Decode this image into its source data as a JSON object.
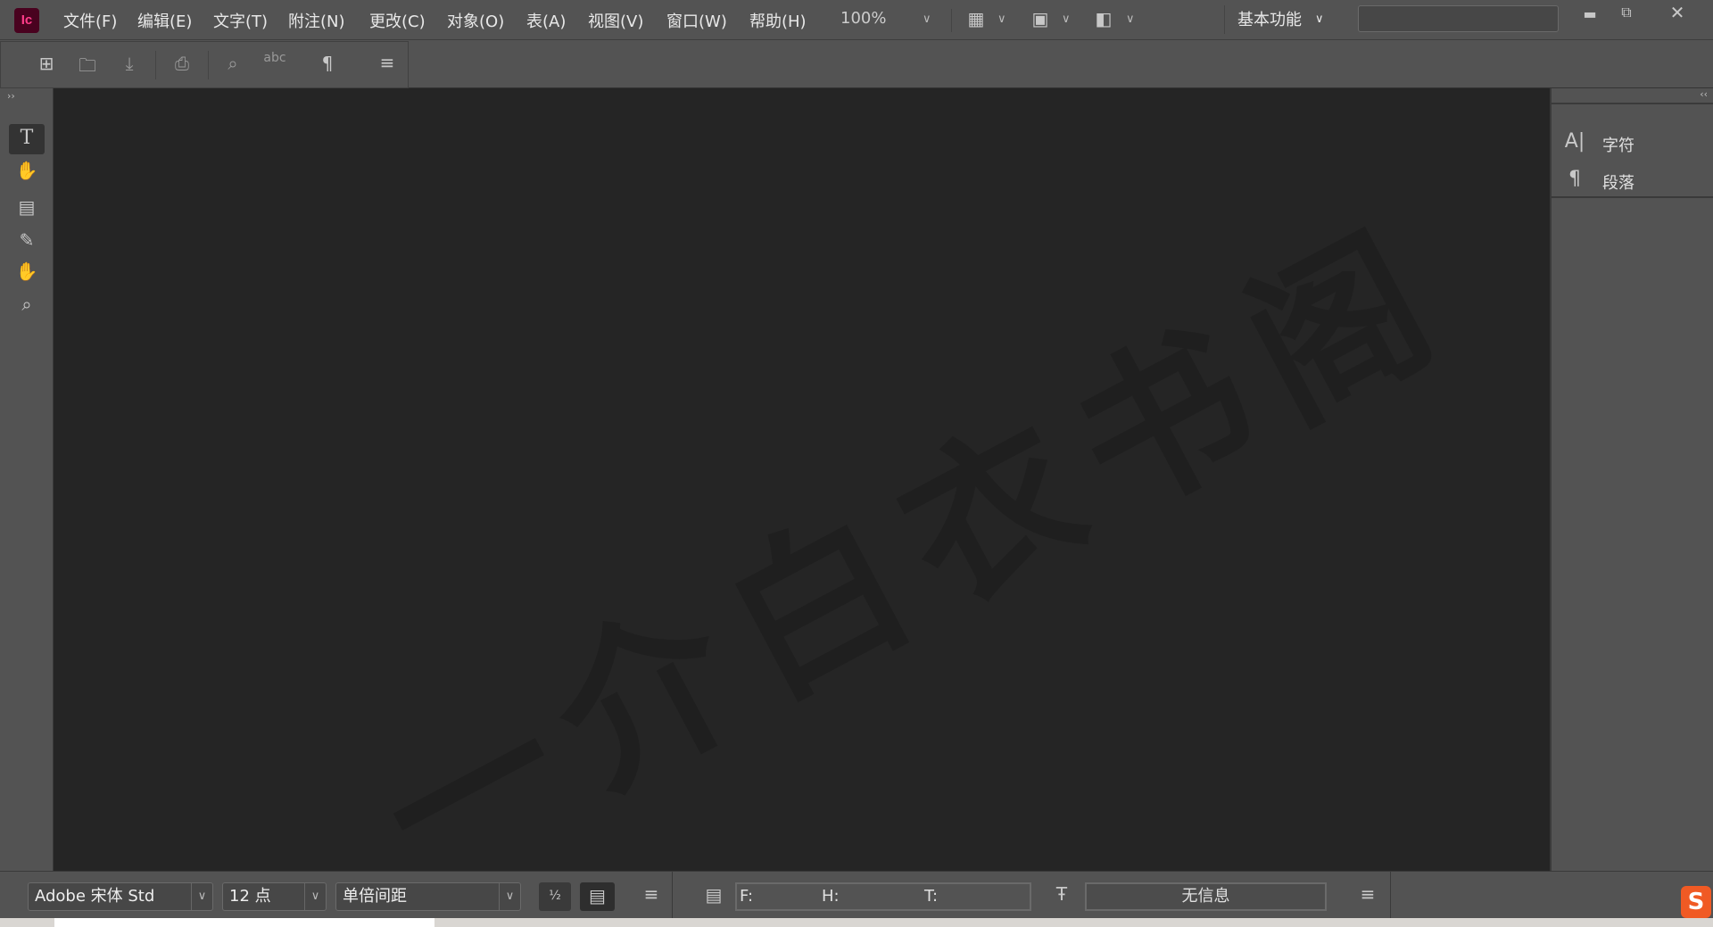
{
  "app": {
    "logo": "Ic"
  },
  "menu": [
    "文件(F)",
    "编辑(E)",
    "文字(T)",
    "附注(N)",
    "更改(C)",
    "对象(O)",
    "表(A)",
    "视图(V)",
    "窗口(W)",
    "帮助(H)"
  ],
  "zoom": "100%",
  "workspace": "基本功能",
  "search": {
    "value": ""
  },
  "right_panel": {
    "items": [
      {
        "icon": "character-icon",
        "label": "字符"
      },
      {
        "icon": "paragraph-icon",
        "label": "段落"
      }
    ]
  },
  "bottom": {
    "font": "Adobe 宋体 Std",
    "size": "12 点",
    "leading": "单倍间距",
    "f_label": "F:",
    "h_label": "H:",
    "t_label": "T:",
    "info": "无信息"
  },
  "watermark": "一介白衣书阁",
  "colors": {
    "accent": "#ff3d8a",
    "logo_bg": "#49021f",
    "canvas": "#252525",
    "panel": "#535353"
  }
}
